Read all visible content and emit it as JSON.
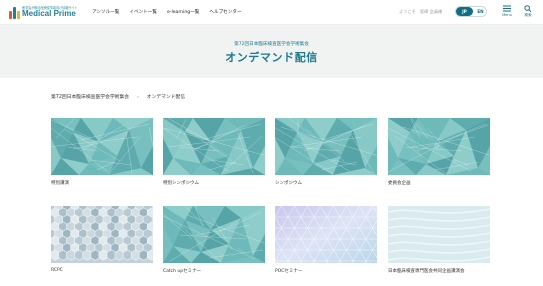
{
  "header": {
    "logo_tagline": "医学会が贈る医療従事者向け情報サイト",
    "logo_brand": "Medical Prime",
    "nav": [
      {
        "label": "アンソルー覧"
      },
      {
        "label": "イベント一覧"
      },
      {
        "label": "e-learning一覧"
      },
      {
        "label": "ヘルプセンター"
      }
    ],
    "welcome": "ようこそ　医師 会員様",
    "lang_jp": "JP",
    "lang_en": "EN",
    "menu_label": "Menu",
    "search_label": "検索"
  },
  "hero": {
    "subtitle": "第72回日本臨床検査医学会学術集会",
    "title": "オンデマンド配信"
  },
  "breadcrumb": {
    "items": [
      "第72回日本臨床検査医学会学術集会",
      "オンデマンド配信"
    ],
    "separator": "›"
  },
  "cards": [
    {
      "label": "特別講演",
      "pattern": "teal-lines"
    },
    {
      "label": "特別シンポジウム",
      "pattern": "teal-lines"
    },
    {
      "label": "シンポジウム",
      "pattern": "teal-lines"
    },
    {
      "label": "委員会企画",
      "pattern": "teal-lines"
    },
    {
      "label": "RCPC",
      "pattern": "hex-mosaic"
    },
    {
      "label": "Catch upセミナー",
      "pattern": "teal-lines"
    },
    {
      "label": "POCセミナー",
      "pattern": "violet-triangles"
    },
    {
      "label": "日本臨床検査専門医会共同企画講演会",
      "pattern": "pale-waves"
    }
  ],
  "colors": {
    "accent": "#0f6d86",
    "brand": "#1f7f97",
    "hero_bg": "#f1f2f2",
    "thumb_teal": "#5fb0b2"
  }
}
